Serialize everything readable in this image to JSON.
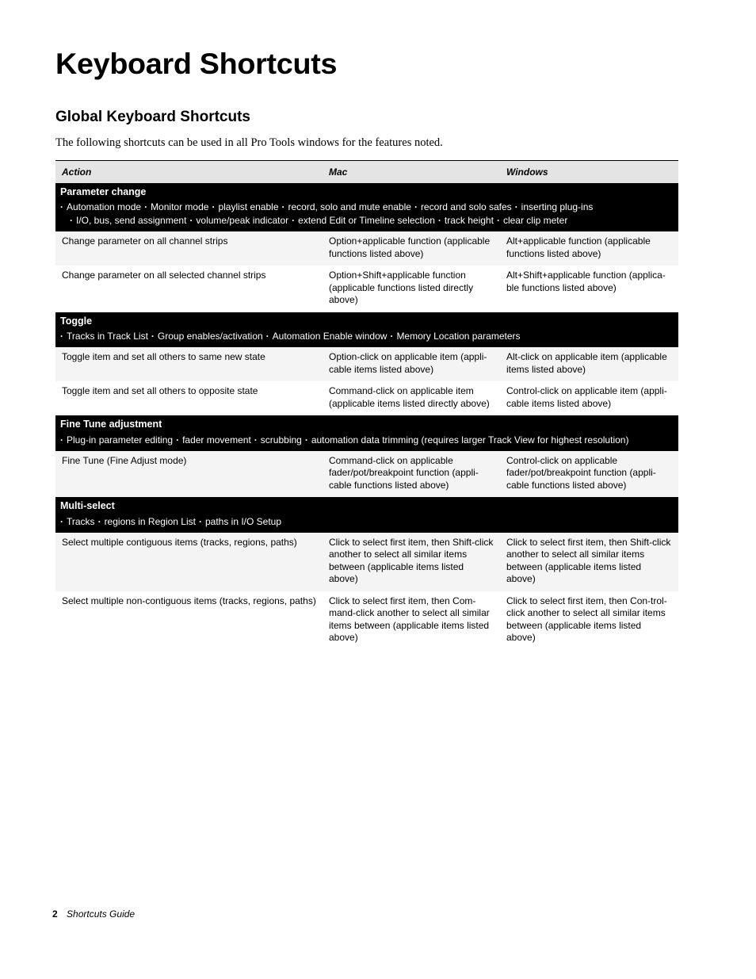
{
  "page": {
    "title": "Keyboard Shortcuts",
    "section_title": "Global Keyboard Shortcuts",
    "intro": "The following shortcuts can be used in all Pro Tools windows for the features noted."
  },
  "table": {
    "headers": {
      "action": "Action",
      "mac": "Mac",
      "windows": "Windows"
    },
    "groups": [
      {
        "title": "Parameter change",
        "items_line1": [
          "Automation mode",
          "Monitor mode",
          "playlist enable",
          "record, solo and mute enable",
          "record and solo safes",
          "inserting plug-ins"
        ],
        "items_line2": [
          "I/O, bus, send assignment",
          "volume/peak indicator",
          "extend Edit or Timeline selection",
          "track height",
          "clear clip meter"
        ],
        "rows": [
          {
            "action": "Change parameter on all channel strips",
            "mac": "Option+applicable function (applicable functions listed above)",
            "windows": "Alt+applicable function (applicable functions listed above)"
          },
          {
            "action": "Change parameter on all selected channel strips",
            "mac": "Option+Shift+applicable function (applicable functions listed directly above)",
            "windows": "Alt+Shift+applicable function (applica-ble functions listed above)"
          }
        ]
      },
      {
        "title": "Toggle",
        "items_line1": [
          "Tracks in Track List",
          "Group enables/activation",
          "Automation Enable window",
          "Memory Location parameters"
        ],
        "items_line2": [],
        "rows": [
          {
            "action": "Toggle item and set all others to same new state",
            "mac": "Option-click on applicable item (appli-cable items listed above)",
            "windows": "Alt-click on applicable item (applicable items listed above)"
          },
          {
            "action": "Toggle item and set all others to opposite state",
            "mac": "Command-click on applicable item (applicable items listed directly above)",
            "windows": "Control-click on applicable item (appli-cable items listed above)"
          }
        ]
      },
      {
        "title": "Fine Tune adjustment",
        "items_line1": [
          "Plug-in parameter editing",
          "fader movement",
          "scrubbing",
          "automation data trimming (requires larger Track View for highest resolution)"
        ],
        "items_line2": [],
        "rows": [
          {
            "action": "Fine Tune (Fine Adjust mode)",
            "mac": "Command-click on applicable fader/pot/breakpoint function (appli-cable functions listed above)",
            "windows": "Control-click on applicable fader/pot/breakpoint function (appli-cable functions listed above)"
          }
        ]
      },
      {
        "title": "Multi-select",
        "items_line1": [
          "Tracks",
          "regions in Region List",
          "paths in I/O Setup"
        ],
        "items_line2": [],
        "rows": [
          {
            "action": "Select multiple contiguous items (tracks, regions, paths)",
            "mac": "Click to select first item, then Shift-click another to select all similar items between (applicable items listed above)",
            "windows": "Click to select first item, then Shift-click another to select all similar items between (applicable items listed above)"
          },
          {
            "action": "Select multiple non-contiguous items (tracks, regions, paths)",
            "mac": "Click to select first item, then Com-mand-click another to select all similar items between (applicable items listed above)",
            "windows": "Click to select first item, then Con-trol-click another to select all similar items between (applicable items listed above)"
          }
        ]
      }
    ]
  },
  "footer": {
    "page_number": "2",
    "guide_name": "Shortcuts Guide"
  },
  "colors": {
    "header_bg": "#e4e4e4",
    "group_bg": "#000000",
    "group_text": "#ffffff",
    "shaded_row": "#f4f4f4"
  }
}
